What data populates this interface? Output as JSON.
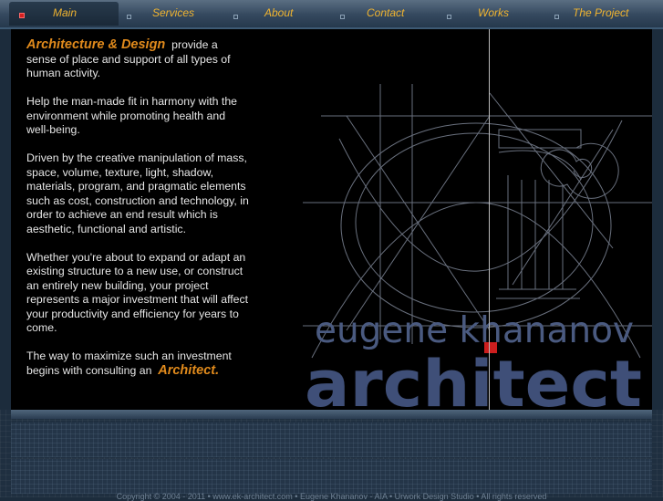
{
  "nav": {
    "items": [
      {
        "label": "Main",
        "active": true
      },
      {
        "label": "Services",
        "active": false
      },
      {
        "label": "About",
        "active": false
      },
      {
        "label": "Contact",
        "active": false
      },
      {
        "label": "Works",
        "active": false
      },
      {
        "label": "The Project",
        "active": false
      }
    ]
  },
  "content": {
    "p1_highlight": "Architecture & Design",
    "p1_rest": "provide a sense of place and support of all types of human activity.",
    "p2": "Help the man-made fit in harmony with the environment while promoting health and well-being.",
    "p3": "Driven by the creative manipulation of mass, space, volume, texture, light, shadow, materials, program, and pragmatic elements such as cost, construction and technology, in order to achieve an end result which is aesthetic, functional and artistic.",
    "p4": "Whether you're about to expand or adapt an existing structure to a new use, or construct an entirely new building, your project represents a major investment that will affect your productivity and efficiency for years to come.",
    "p5_pre": "The way to maximize such an investment begins with consulting an",
    "p5_highlight": "Architect."
  },
  "logo": {
    "line1": "eugene khananov",
    "line2": "architect"
  },
  "footer": {
    "copyright": "Copyright © 2004 - 2011 • www.ek-architect.com • Eugene Khananov - AIA • Urwork Design Studio • All rights reserved"
  },
  "colors": {
    "accent": "#e08a1c",
    "nav_label": "#f0b430",
    "logo_text": "#4a5a80",
    "logo_dot": "#cc1e1e"
  }
}
